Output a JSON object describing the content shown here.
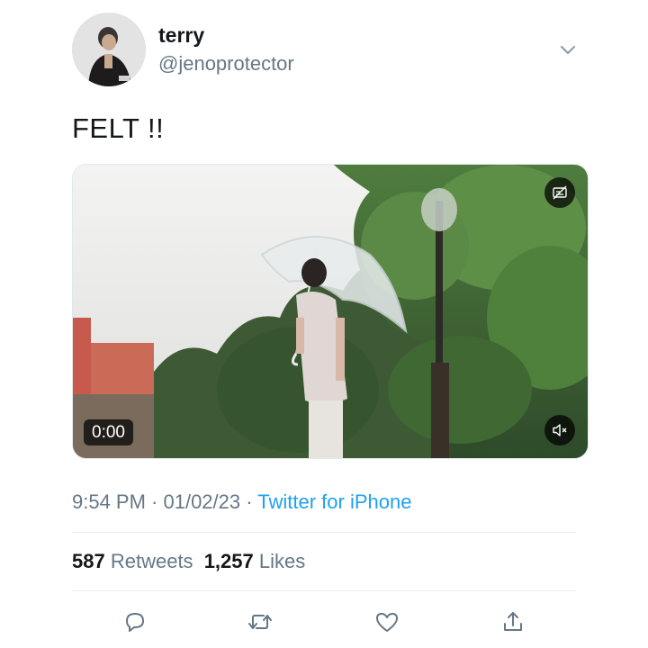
{
  "tweet": {
    "author": {
      "display_name": "terry",
      "handle": "@jenoprotector",
      "avatar": "profile-photo"
    },
    "text": "FELT !!",
    "media": {
      "type": "video",
      "duration_label": "0:00",
      "muted": true,
      "subject": "person holding clear umbrella in rain among trees"
    },
    "timestamp": "9:54 PM · 01/02/23 · ",
    "source": "Twitter for iPhone",
    "stats": {
      "retweets_count": "587",
      "retweets_label": "Retweets",
      "likes_count": "1,257",
      "likes_label": "Likes"
    },
    "actions": {
      "reply_icon": "reply-icon",
      "retweet_icon": "retweet-icon",
      "like_icon": "heart-icon",
      "share_icon": "share-icon"
    },
    "colors": {
      "link": "#1da1f2",
      "secondary_text": "#657786",
      "primary_text": "#14171a",
      "divider": "#e6ecf0"
    }
  }
}
